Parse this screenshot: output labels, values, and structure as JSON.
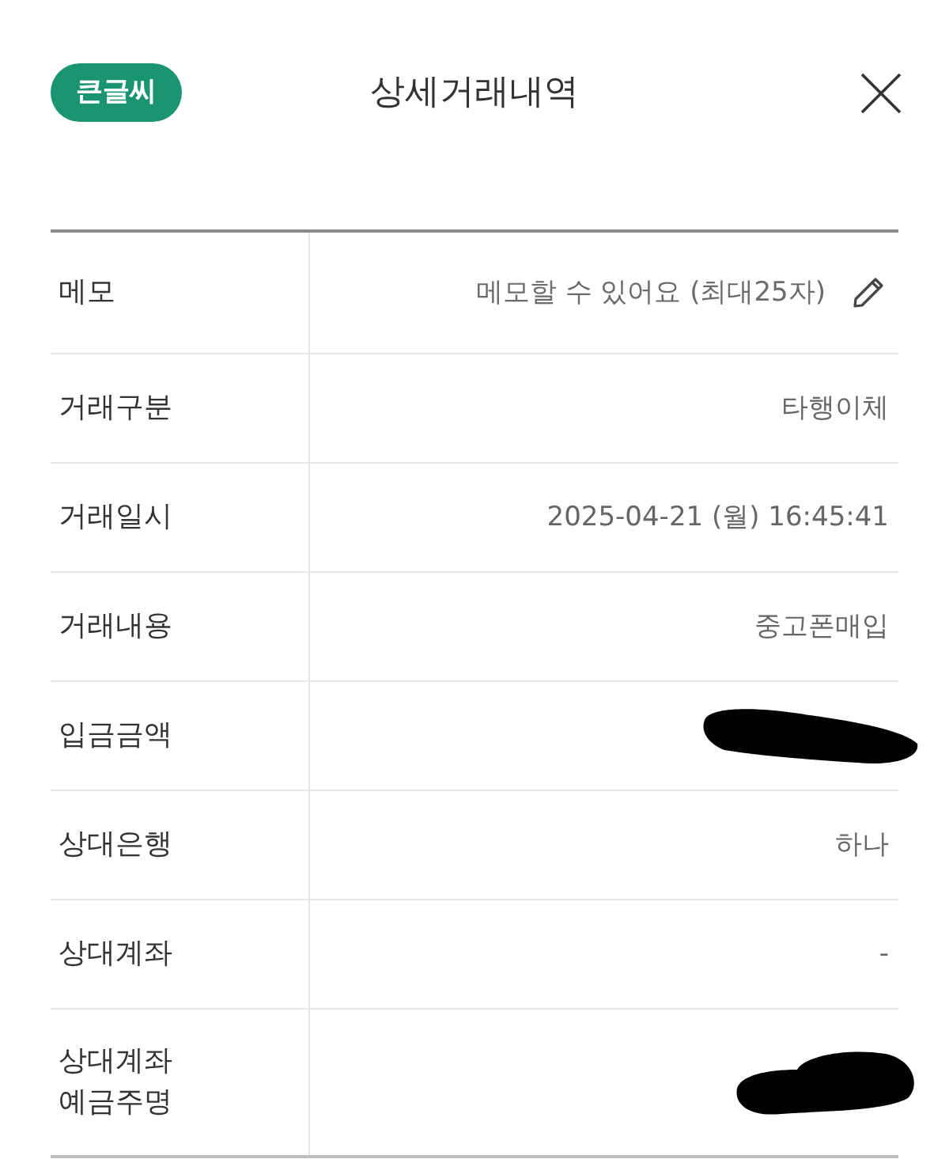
{
  "header": {
    "badge": "큰글씨",
    "title": "상세거래내역"
  },
  "rows": [
    {
      "kind": "memo",
      "label": "메모",
      "placeholder": "메모할 수 있어요 (최대25자)"
    },
    {
      "kind": "text",
      "label": "거래구분",
      "value": "타행이체"
    },
    {
      "kind": "text",
      "label": "거래일시",
      "value": "2025-04-21 (월) 16:45:41"
    },
    {
      "kind": "text",
      "label": "거래내용",
      "value": "중고폰매입"
    },
    {
      "kind": "redacted",
      "label": "입금금액"
    },
    {
      "kind": "text",
      "label": "상대은행",
      "value": "하나"
    },
    {
      "kind": "text",
      "label": "상대계좌",
      "value": "-"
    },
    {
      "kind": "redacted",
      "label": "상대계좌\n예금주명"
    }
  ]
}
